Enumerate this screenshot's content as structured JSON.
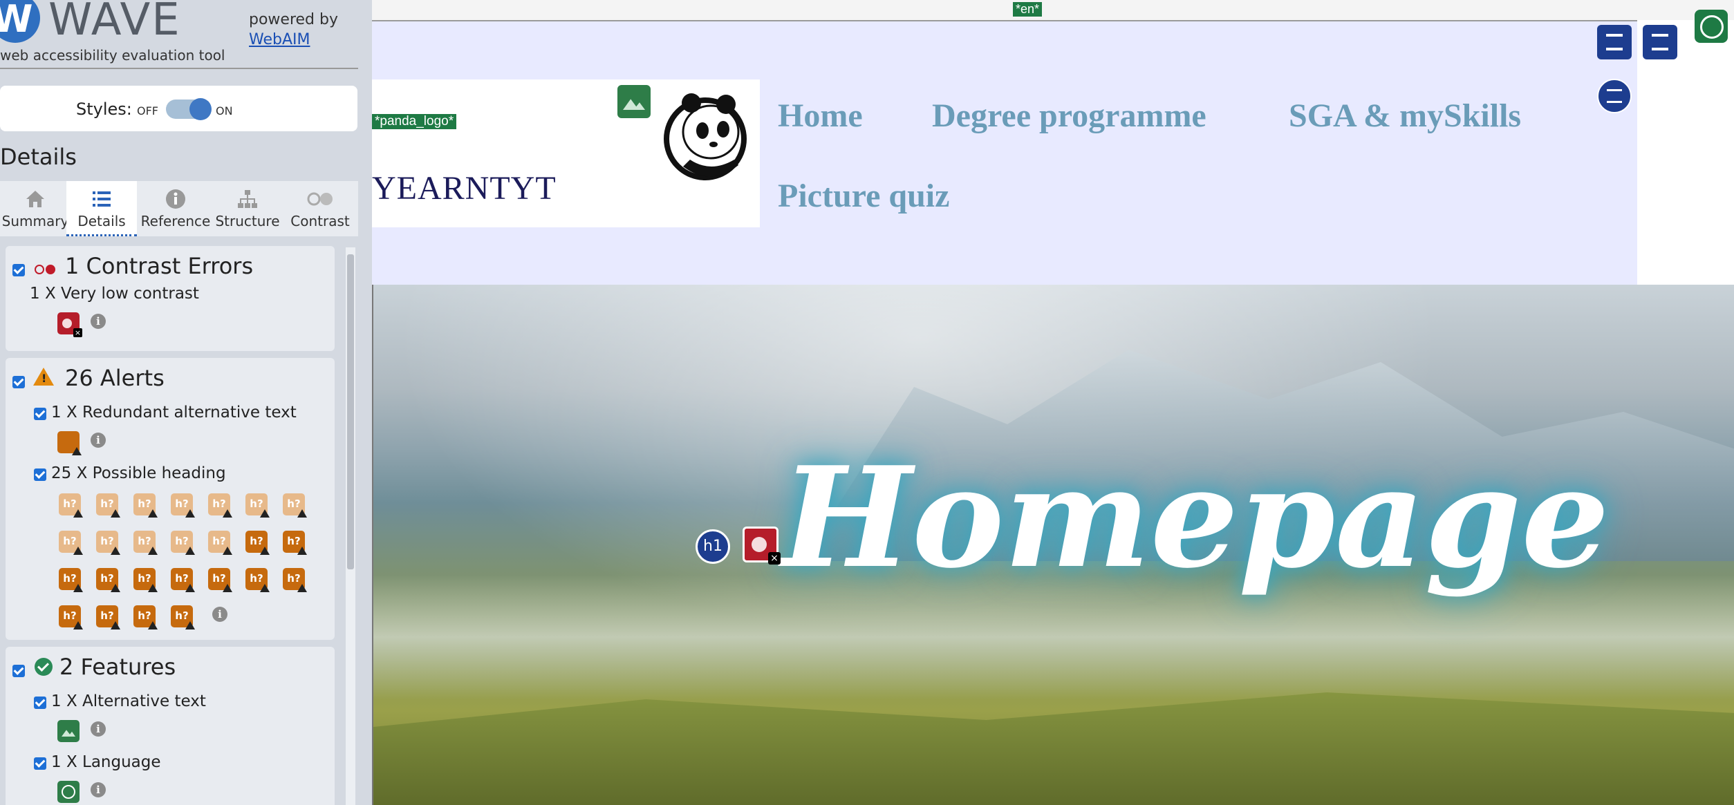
{
  "wave": {
    "brand": "WAVE",
    "tagline": "web accessibility evaluation tool",
    "powered_by": "powered by",
    "webaim_link": "WebAIM",
    "styles": {
      "label": "Styles:",
      "off": "OFF",
      "on": "ON"
    },
    "details_heading": "Details",
    "tabs": [
      {
        "label": "Summary",
        "icon": "home-icon"
      },
      {
        "label": "Details",
        "icon": "list-icon",
        "active": true
      },
      {
        "label": "Reference",
        "icon": "info-icon"
      },
      {
        "label": "Structure",
        "icon": "structure-icon"
      },
      {
        "label": "Contrast",
        "icon": "contrast-icon"
      }
    ],
    "contrast": {
      "title": "1 Contrast Errors",
      "items": [
        {
          "text": "1 X Very low contrast"
        }
      ]
    },
    "alerts": {
      "title": "26 Alerts",
      "items": [
        {
          "text": "1 X Redundant alternative text"
        },
        {
          "text": "25 X Possible heading"
        }
      ],
      "heading_icon_text": "h?"
    },
    "features": {
      "title": "2 Features",
      "items": [
        {
          "text": "1 X Alternative text"
        },
        {
          "text": "1 X Language"
        }
      ]
    },
    "colors": {
      "accent": "#2a63b8",
      "error": "#b51d2a",
      "alert": "#c66a0e",
      "feature": "#2e7d48"
    }
  },
  "page": {
    "lang_tag": "*en*",
    "logo_alt_tag": "*panda_logo*",
    "site_name": "YEARNTYT",
    "nav": [
      "Home",
      "Degree programme",
      "SGA & mySkills",
      "Picture quiz"
    ],
    "hero_title": "Homepage",
    "h1_badge": "h1",
    "colors": {
      "nav": "#6a9cb8",
      "background": "#e8eaff",
      "wave_tag": "#1e7a44"
    }
  }
}
